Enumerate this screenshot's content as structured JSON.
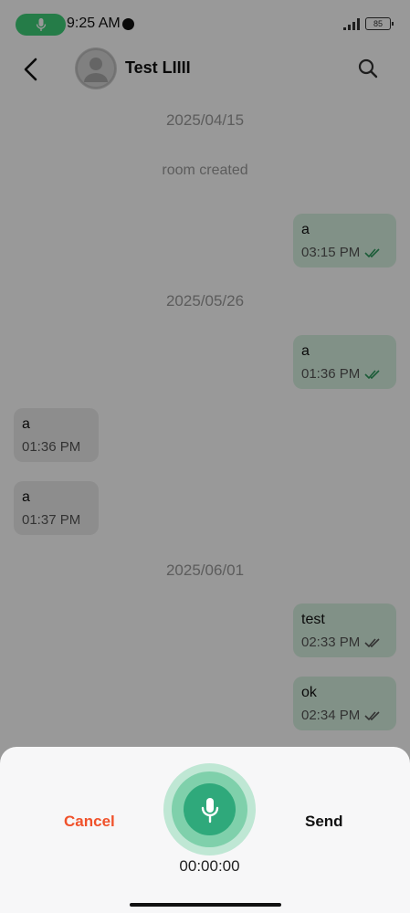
{
  "status_bar": {
    "time": "9:25 AM",
    "battery": "85"
  },
  "header": {
    "title": "Test LIIII"
  },
  "messages": [
    {
      "type": "date",
      "text": "2025/04/15"
    },
    {
      "type": "system",
      "text": "room created"
    },
    {
      "type": "outgoing",
      "text": "a",
      "time": "03:15 PM"
    },
    {
      "type": "date",
      "text": "2025/05/26"
    },
    {
      "type": "outgoing",
      "text": "a",
      "time": "01:36 PM"
    },
    {
      "type": "incoming",
      "text": "a",
      "time": "01:36 PM"
    },
    {
      "type": "incoming",
      "text": "a",
      "time": "01:37 PM"
    },
    {
      "type": "date",
      "text": "2025/06/01"
    },
    {
      "type": "outgoing",
      "text": "test",
      "time": "02:33 PM"
    },
    {
      "type": "outgoing",
      "text": "ok",
      "time": "02:34 PM"
    }
  ],
  "recorder": {
    "cancel_label": "Cancel",
    "send_label": "Send",
    "timer": "00:00:00"
  },
  "colors": {
    "accent_green": "#2fa97b",
    "cancel_red": "#f0522b",
    "outgoing_bubble": "#d8f2e1",
    "incoming_bubble": "#ececec"
  }
}
